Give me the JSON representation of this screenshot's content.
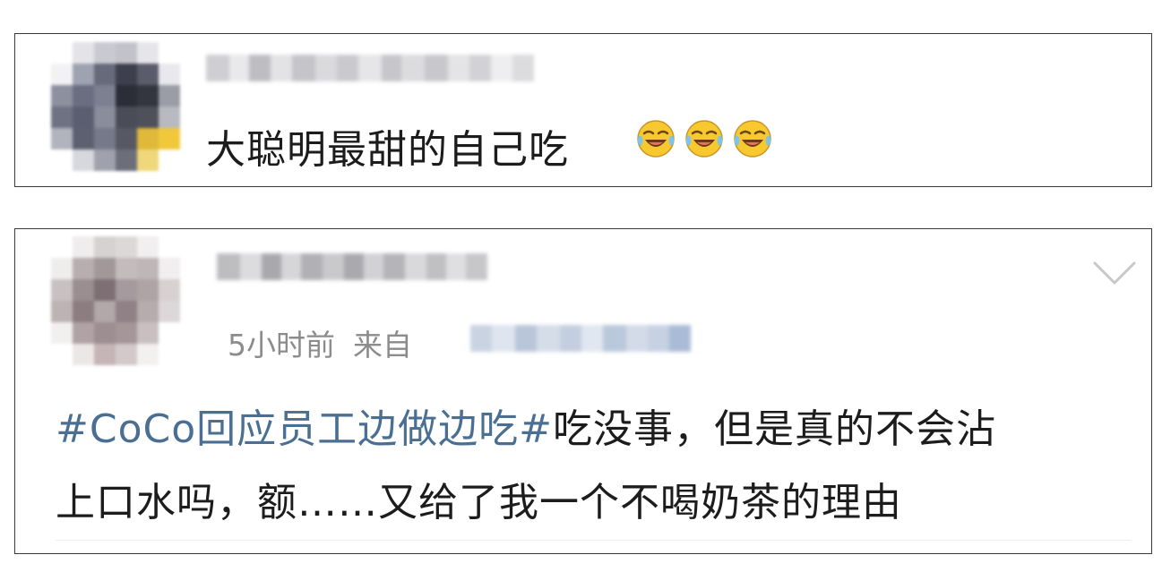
{
  "comment": {
    "text": "大聪明最甜的自己吃",
    "emoji_name": "laughing-crying-emoji",
    "emoji_count": 3
  },
  "post": {
    "time": "5小时前",
    "source_label": "来自",
    "topic": "#CoCo回应员工边做边吃#",
    "line1_rest": "吃没事，但是真的不会沾",
    "line2": "上口水吗，额……又给了我一个不喝奶茶的理由"
  },
  "colors": {
    "topic_link": "#4a6f92",
    "meta_text": "#8c8c8c",
    "body_text": "#1c1c1c"
  }
}
